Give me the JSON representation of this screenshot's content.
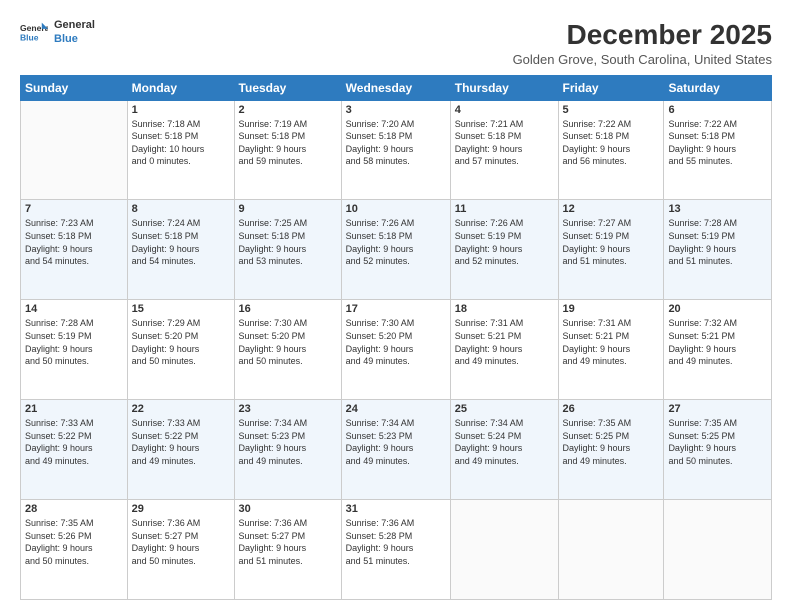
{
  "header": {
    "logo_line1": "General",
    "logo_line2": "Blue",
    "title": "December 2025",
    "subtitle": "Golden Grove, South Carolina, United States"
  },
  "calendar": {
    "days_of_week": [
      "Sunday",
      "Monday",
      "Tuesday",
      "Wednesday",
      "Thursday",
      "Friday",
      "Saturday"
    ],
    "weeks": [
      [
        {
          "day": "",
          "info": ""
        },
        {
          "day": "1",
          "info": "Sunrise: 7:18 AM\nSunset: 5:18 PM\nDaylight: 10 hours\nand 0 minutes."
        },
        {
          "day": "2",
          "info": "Sunrise: 7:19 AM\nSunset: 5:18 PM\nDaylight: 9 hours\nand 59 minutes."
        },
        {
          "day": "3",
          "info": "Sunrise: 7:20 AM\nSunset: 5:18 PM\nDaylight: 9 hours\nand 58 minutes."
        },
        {
          "day": "4",
          "info": "Sunrise: 7:21 AM\nSunset: 5:18 PM\nDaylight: 9 hours\nand 57 minutes."
        },
        {
          "day": "5",
          "info": "Sunrise: 7:22 AM\nSunset: 5:18 PM\nDaylight: 9 hours\nand 56 minutes."
        },
        {
          "day": "6",
          "info": "Sunrise: 7:22 AM\nSunset: 5:18 PM\nDaylight: 9 hours\nand 55 minutes."
        }
      ],
      [
        {
          "day": "7",
          "info": "Sunrise: 7:23 AM\nSunset: 5:18 PM\nDaylight: 9 hours\nand 54 minutes."
        },
        {
          "day": "8",
          "info": "Sunrise: 7:24 AM\nSunset: 5:18 PM\nDaylight: 9 hours\nand 54 minutes."
        },
        {
          "day": "9",
          "info": "Sunrise: 7:25 AM\nSunset: 5:18 PM\nDaylight: 9 hours\nand 53 minutes."
        },
        {
          "day": "10",
          "info": "Sunrise: 7:26 AM\nSunset: 5:18 PM\nDaylight: 9 hours\nand 52 minutes."
        },
        {
          "day": "11",
          "info": "Sunrise: 7:26 AM\nSunset: 5:19 PM\nDaylight: 9 hours\nand 52 minutes."
        },
        {
          "day": "12",
          "info": "Sunrise: 7:27 AM\nSunset: 5:19 PM\nDaylight: 9 hours\nand 51 minutes."
        },
        {
          "day": "13",
          "info": "Sunrise: 7:28 AM\nSunset: 5:19 PM\nDaylight: 9 hours\nand 51 minutes."
        }
      ],
      [
        {
          "day": "14",
          "info": "Sunrise: 7:28 AM\nSunset: 5:19 PM\nDaylight: 9 hours\nand 50 minutes."
        },
        {
          "day": "15",
          "info": "Sunrise: 7:29 AM\nSunset: 5:20 PM\nDaylight: 9 hours\nand 50 minutes."
        },
        {
          "day": "16",
          "info": "Sunrise: 7:30 AM\nSunset: 5:20 PM\nDaylight: 9 hours\nand 50 minutes."
        },
        {
          "day": "17",
          "info": "Sunrise: 7:30 AM\nSunset: 5:20 PM\nDaylight: 9 hours\nand 49 minutes."
        },
        {
          "day": "18",
          "info": "Sunrise: 7:31 AM\nSunset: 5:21 PM\nDaylight: 9 hours\nand 49 minutes."
        },
        {
          "day": "19",
          "info": "Sunrise: 7:31 AM\nSunset: 5:21 PM\nDaylight: 9 hours\nand 49 minutes."
        },
        {
          "day": "20",
          "info": "Sunrise: 7:32 AM\nSunset: 5:21 PM\nDaylight: 9 hours\nand 49 minutes."
        }
      ],
      [
        {
          "day": "21",
          "info": "Sunrise: 7:33 AM\nSunset: 5:22 PM\nDaylight: 9 hours\nand 49 minutes."
        },
        {
          "day": "22",
          "info": "Sunrise: 7:33 AM\nSunset: 5:22 PM\nDaylight: 9 hours\nand 49 minutes."
        },
        {
          "day": "23",
          "info": "Sunrise: 7:34 AM\nSunset: 5:23 PM\nDaylight: 9 hours\nand 49 minutes."
        },
        {
          "day": "24",
          "info": "Sunrise: 7:34 AM\nSunset: 5:23 PM\nDaylight: 9 hours\nand 49 minutes."
        },
        {
          "day": "25",
          "info": "Sunrise: 7:34 AM\nSunset: 5:24 PM\nDaylight: 9 hours\nand 49 minutes."
        },
        {
          "day": "26",
          "info": "Sunrise: 7:35 AM\nSunset: 5:25 PM\nDaylight: 9 hours\nand 49 minutes."
        },
        {
          "day": "27",
          "info": "Sunrise: 7:35 AM\nSunset: 5:25 PM\nDaylight: 9 hours\nand 50 minutes."
        }
      ],
      [
        {
          "day": "28",
          "info": "Sunrise: 7:35 AM\nSunset: 5:26 PM\nDaylight: 9 hours\nand 50 minutes."
        },
        {
          "day": "29",
          "info": "Sunrise: 7:36 AM\nSunset: 5:27 PM\nDaylight: 9 hours\nand 50 minutes."
        },
        {
          "day": "30",
          "info": "Sunrise: 7:36 AM\nSunset: 5:27 PM\nDaylight: 9 hours\nand 51 minutes."
        },
        {
          "day": "31",
          "info": "Sunrise: 7:36 AM\nSunset: 5:28 PM\nDaylight: 9 hours\nand 51 minutes."
        },
        {
          "day": "",
          "info": ""
        },
        {
          "day": "",
          "info": ""
        },
        {
          "day": "",
          "info": ""
        }
      ]
    ]
  }
}
